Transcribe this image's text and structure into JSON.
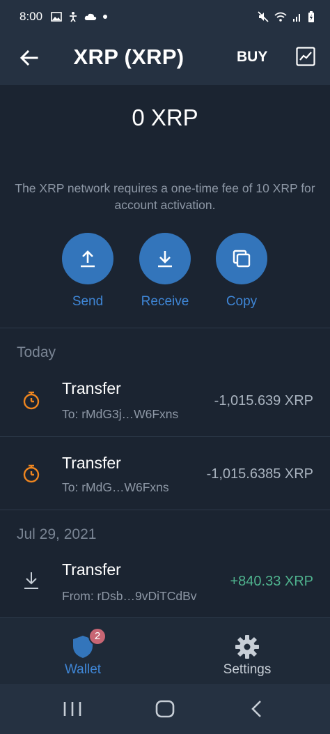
{
  "status_bar": {
    "time": "8:00"
  },
  "app_bar": {
    "title": "XRP (XRP)",
    "buy_label": "BUY"
  },
  "balance": "0 XRP",
  "notice": "The XRP network requires a one-time fee of 10 XRP for account activation.",
  "actions": [
    {
      "label": "Send",
      "icon": "upload-icon"
    },
    {
      "label": "Receive",
      "icon": "download-icon"
    },
    {
      "label": "Copy",
      "icon": "copy-icon"
    }
  ],
  "sections": [
    {
      "header": "Today",
      "transactions": [
        {
          "title": "Transfer",
          "subtitle": "To: rMdG3j…W6Fxns",
          "amount": "-1,015.639 XRP",
          "status_icon": "pending-timer-icon"
        },
        {
          "title": "Transfer",
          "subtitle": "To: rMdG…W6Fxns",
          "amount": "-1,015.6385 XRP",
          "status_icon": "pending-timer-icon"
        }
      ]
    },
    {
      "header": "Jul 29, 2021",
      "transactions": [
        {
          "title": "Transfer",
          "subtitle": "From: rDsb…9vDiTCdBv",
          "amount": "+840.33 XRP",
          "status_icon": "received-icon"
        }
      ]
    }
  ],
  "bottom_nav": {
    "wallet_label": "Wallet",
    "wallet_badge": "2",
    "settings_label": "Settings"
  },
  "colors": {
    "background": "#1b2431",
    "accent": "#3375bb",
    "pending": "#f0861f",
    "positive": "#4fb38e",
    "badge": "#c86674"
  }
}
